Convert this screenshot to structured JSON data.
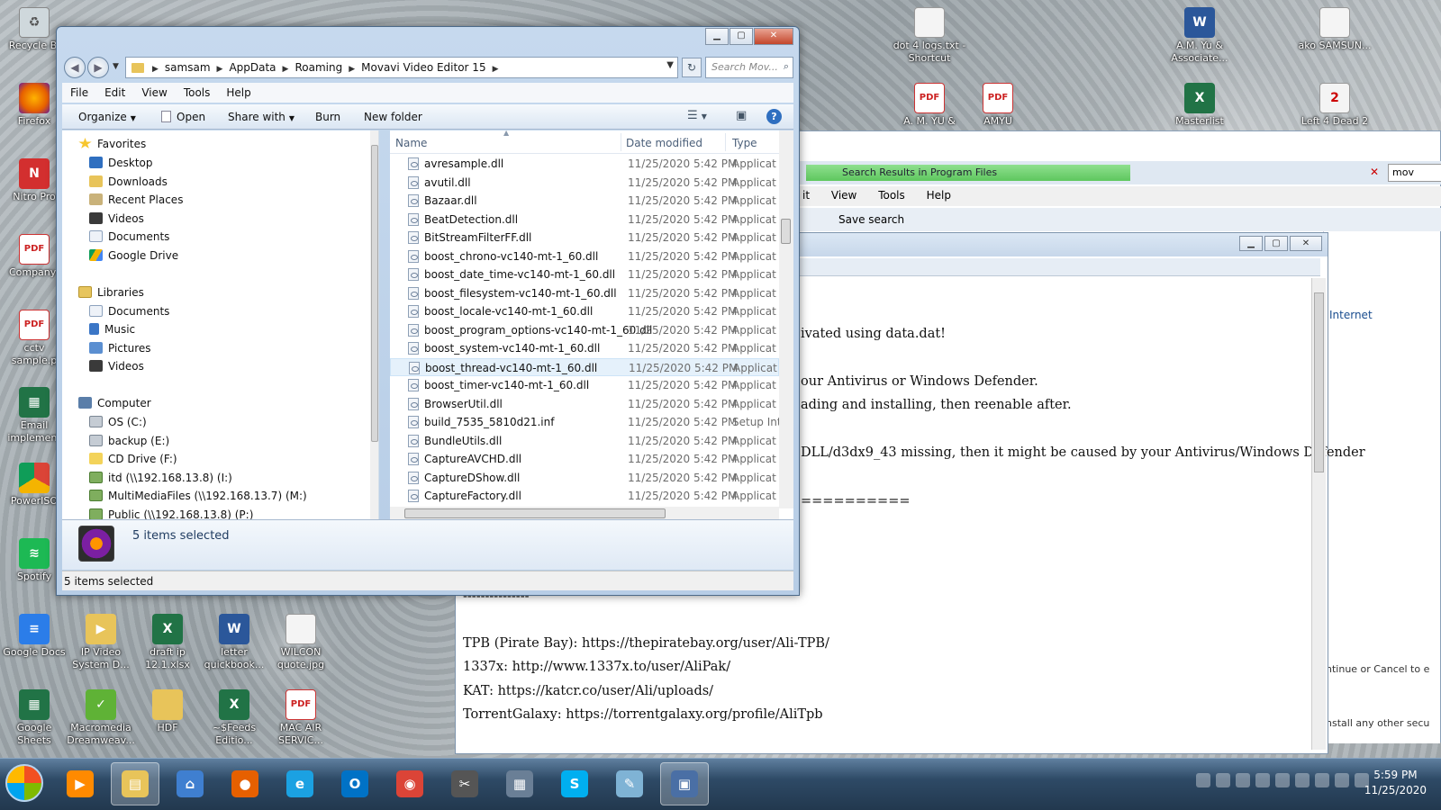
{
  "desktop": {
    "icons_left": [
      {
        "label": "Recycle Bi",
        "icon": "recycle-bin-icon"
      },
      {
        "label": "Firefox",
        "icon": "firefox-icon"
      },
      {
        "label": "Nitro Pro",
        "icon": "nitro-pro-icon"
      },
      {
        "label": "Company-",
        "icon": "pdf-icon"
      },
      {
        "label": "cctv sample.p",
        "icon": "pdf-icon"
      },
      {
        "label": "Email implement",
        "icon": "google-sheets-icon"
      },
      {
        "label": "PowerISO",
        "icon": "poweriso-icon"
      },
      {
        "label": "Spotify",
        "icon": "spotify-icon"
      }
    ],
    "icons_bottom": [
      {
        "label": "Google Docs",
        "icon": "google-docs-icon"
      },
      {
        "label": "IP Video System D...",
        "icon": "ip-video-icon"
      },
      {
        "label": "draft ip 12.1.xlsx",
        "icon": "excel-icon"
      },
      {
        "label": "letter quickbook...",
        "icon": "word-icon"
      },
      {
        "label": "WILCON quote.jpg",
        "icon": "image-file-icon"
      },
      {
        "label": "Google Sheets",
        "icon": "google-sheets-icon"
      },
      {
        "label": "Macromedia Dreamweav...",
        "icon": "dreamweaver-icon"
      },
      {
        "label": "HDF",
        "icon": "folder-icon"
      },
      {
        "label": "~$Feeds Editio...",
        "icon": "excel-icon"
      },
      {
        "label": "MAC AIR SERVIC...",
        "icon": "pdf-icon"
      }
    ],
    "icons_top_right": [
      {
        "label": "dot 4 logs.txt - Shortcut",
        "icon": "text-shortcut-icon"
      },
      {
        "label": "A.M. Yu & Associate...",
        "icon": "word-icon"
      },
      {
        "label": "ako SAMSUN...",
        "icon": "file-icon"
      },
      {
        "label": "A. M. YU &",
        "icon": "pdf-icon"
      },
      {
        "label": "AMYU",
        "icon": "pdf-icon"
      },
      {
        "label": "Masterlist",
        "icon": "excel-icon"
      },
      {
        "label": "Left 4 Dead 2",
        "icon": "game-icon"
      }
    ]
  },
  "explorer": {
    "breadcrumb": [
      "samsam",
      "AppData",
      "Roaming",
      "Movavi Video Editor 15"
    ],
    "search_placeholder": "Search Mov...",
    "menu": [
      "File",
      "Edit",
      "View",
      "Tools",
      "Help"
    ],
    "commands": {
      "organize": "Organize",
      "open": "Open",
      "share_with": "Share with",
      "burn": "Burn",
      "new_folder": "New folder"
    },
    "nav": {
      "favorites": "Favorites",
      "favorites_items": [
        "Desktop",
        "Downloads",
        "Recent Places",
        "Videos",
        "Documents",
        "Google Drive"
      ],
      "libraries": "Libraries",
      "libraries_items": [
        "Documents",
        "Music",
        "Pictures",
        "Videos"
      ],
      "computer": "Computer",
      "computer_items": [
        "OS (C:)",
        "backup (E:)",
        "CD Drive (F:)",
        "itd (\\\\192.168.13.8) (I:)",
        "MultiMediaFiles (\\\\192.168.13.7) (M:)",
        "Public (\\\\192.168.13.8) (P:)"
      ]
    },
    "columns": {
      "name": "Name",
      "date": "Date modified",
      "type": "Type"
    },
    "files": [
      {
        "name": "avresample.dll",
        "date": "11/25/2020 5:42 PM",
        "type": "Applicat"
      },
      {
        "name": "avutil.dll",
        "date": "11/25/2020 5:42 PM",
        "type": "Applicat"
      },
      {
        "name": "Bazaar.dll",
        "date": "11/25/2020 5:42 PM",
        "type": "Applicat"
      },
      {
        "name": "BeatDetection.dll",
        "date": "11/25/2020 5:42 PM",
        "type": "Applicat"
      },
      {
        "name": "BitStreamFilterFF.dll",
        "date": "11/25/2020 5:42 PM",
        "type": "Applicat"
      },
      {
        "name": "boost_chrono-vc140-mt-1_60.dll",
        "date": "11/25/2020 5:42 PM",
        "type": "Applicat"
      },
      {
        "name": "boost_date_time-vc140-mt-1_60.dll",
        "date": "11/25/2020 5:42 PM",
        "type": "Applicat"
      },
      {
        "name": "boost_filesystem-vc140-mt-1_60.dll",
        "date": "11/25/2020 5:42 PM",
        "type": "Applicat"
      },
      {
        "name": "boost_locale-vc140-mt-1_60.dll",
        "date": "11/25/2020 5:42 PM",
        "type": "Applicat"
      },
      {
        "name": "boost_program_options-vc140-mt-1_60.dll",
        "date": "11/25/2020 5:42 PM",
        "type": "Applicat"
      },
      {
        "name": "boost_system-vc140-mt-1_60.dll",
        "date": "11/25/2020 5:42 PM",
        "type": "Applicat"
      },
      {
        "name": "boost_thread-vc140-mt-1_60.dll",
        "date": "11/25/2020 5:42 PM",
        "type": "Applicat"
      },
      {
        "name": "boost_timer-vc140-mt-1_60.dll",
        "date": "11/25/2020 5:42 PM",
        "type": "Applicat"
      },
      {
        "name": "BrowserUtil.dll",
        "date": "11/25/2020 5:42 PM",
        "type": "Applicat"
      },
      {
        "name": "build_7535_5810d21.inf",
        "date": "11/25/2020 5:42 PM",
        "type": "Setup Int"
      },
      {
        "name": "BundleUtils.dll",
        "date": "11/25/2020 5:42 PM",
        "type": "Applicat"
      },
      {
        "name": "CaptureAVCHD.dll",
        "date": "11/25/2020 5:42 PM",
        "type": "Applicat"
      },
      {
        "name": "CaptureDShow.dll",
        "date": "11/25/2020 5:42 PM",
        "type": "Applicat"
      },
      {
        "name": "CaptureFactory.dll",
        "date": "11/25/2020 5:42 PM",
        "type": "Applicat"
      }
    ],
    "details_count": "5 items selected",
    "status": "5 items selected"
  },
  "search_window": {
    "address": "Search Results in Program Files",
    "search_text": "mov",
    "menu": [
      "it",
      "View",
      "Tools",
      "Help"
    ],
    "save_search": "Save search",
    "side_link": "Internet",
    "side_text_1": "ntinue or Cancel to e",
    "side_text_2": "nstall any other secu"
  },
  "notes": {
    "lines": [
      "ivated using data.dat!",
      "our Antivirus or Windows Defender.",
      "ading and installing, then reenable after.",
      "DLL/d3dx9_43 missing, then it might be caused by your Antivirus/Windows Defender",
      "==========",
      "---------------",
      "TPB (Pirate Bay): https://thepiratebay.org/user/Ali-TPB/",
      "1337x: http://www.1337x.to/user/AliPak/",
      "KAT: https://katcr.co/user/Ali/uploads/",
      "TorrentGalaxy: https://torrentgalaxy.org/profile/AliTpb"
    ]
  },
  "taskbar": {
    "time": "5:59 PM",
    "date": "11/25/2020",
    "apps": [
      "windows-media-player-icon",
      "windows-explorer-icon",
      "network-manager-icon",
      "firefox-icon",
      "internet-explorer-icon",
      "outlook-icon",
      "chrome-icon",
      "snipping-tool-icon",
      "calculator-icon",
      "skype-icon",
      "notepad-icon",
      "remote-desktop-icon"
    ]
  }
}
